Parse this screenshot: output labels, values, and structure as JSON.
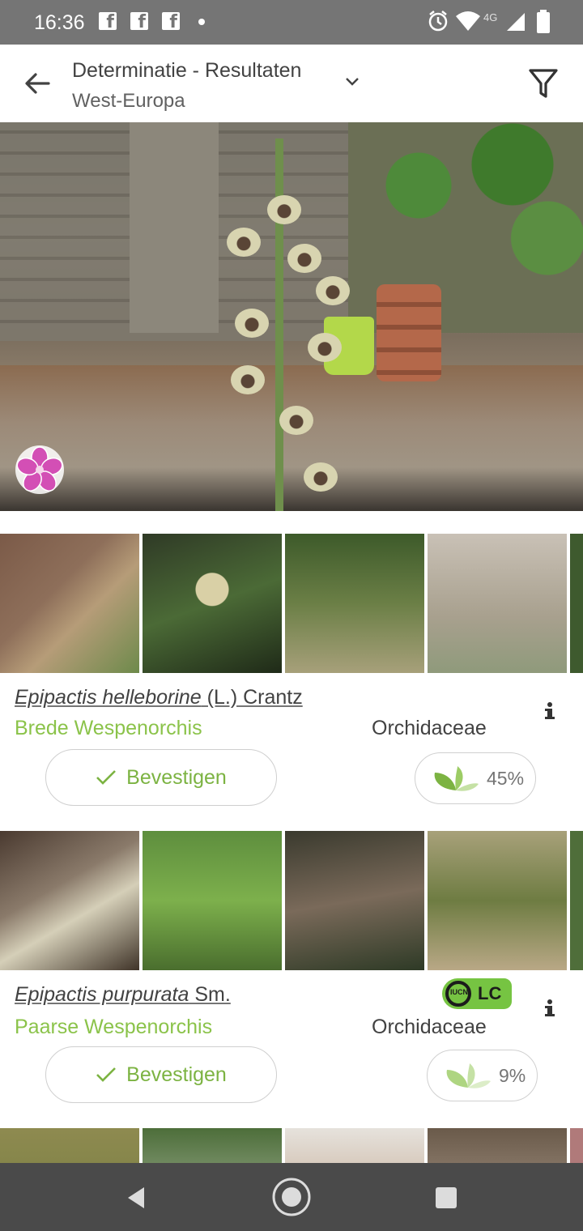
{
  "status_bar": {
    "time": "16:36",
    "network": "4G",
    "battery": "89"
  },
  "app_bar": {
    "title": "Determinatie - Resultaten",
    "subtitle": "West-Europa",
    "back_icon": "arrow-back-icon",
    "filter_icon": "filter-icon"
  },
  "results": [
    {
      "scientific_genus_species": "Epipactis helleborine",
      "author": " (L.) Crantz",
      "common_name": "Brede Wespenorchis",
      "family": "Orchidaceae",
      "confirm_label": "Bevestigen",
      "score": "45%",
      "thumb_count": 5
    },
    {
      "scientific_genus_species": "Epipactis purpurata",
      "author": " Sm.",
      "common_name": "Paarse Wespenorchis",
      "family": "Orchidaceae",
      "confirm_label": "Bevestigen",
      "score": "9%",
      "iucn": {
        "logo_text": "IUCN",
        "status": "LC",
        "color": "#76c442"
      },
      "thumb_count": 5
    }
  ],
  "colors": {
    "accent_green": "#8bc34a",
    "status_bar": "#757575",
    "nav_bar": "#4a4a4a"
  }
}
